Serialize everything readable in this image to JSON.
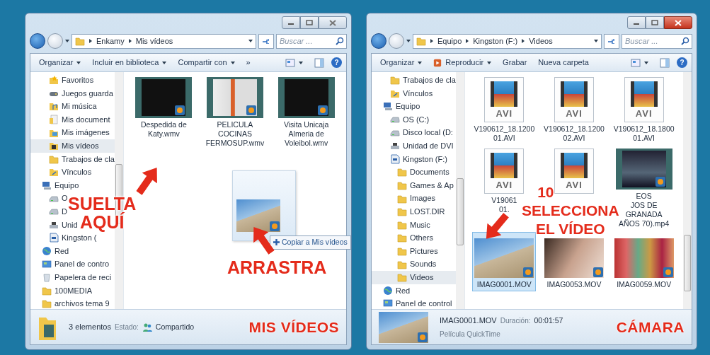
{
  "windows": [
    {
      "active": false,
      "address": [
        "Enkamy",
        "Mis vídeos"
      ],
      "search": {
        "placeholder": "Buscar ..."
      },
      "help": "?",
      "toolbar": [
        {
          "label": "Organizar",
          "dropdown": true
        },
        {
          "label": "Incluir en biblioteca",
          "dropdown": true
        },
        {
          "label": "Compartir con",
          "dropdown": true
        },
        {
          "label": "»",
          "dropdown": false
        }
      ],
      "nav_continued": [
        {
          "label": "Favoritos",
          "kind": "star",
          "selected": false
        },
        {
          "label": "Juegos guarda",
          "kind": "game",
          "selected": false
        },
        {
          "label": "Mi música",
          "kind": "music",
          "selected": false
        },
        {
          "label": "Mis document",
          "kind": "docs",
          "selected": false
        },
        {
          "label": "Mis imágenes",
          "kind": "pics",
          "selected": false
        },
        {
          "label": "Mis vídeos",
          "kind": "vids",
          "selected": true
        },
        {
          "label": "Trabajos de cla",
          "kind": "folder",
          "selected": false
        },
        {
          "label": "Vínculos",
          "kind": "links",
          "selected": false
        }
      ],
      "nav": [
        {
          "label": "Equipo",
          "kind": "computer",
          "selected": false,
          "children": [
            {
              "label": "O",
              "kind": "drive",
              "selected": false
            },
            {
              "label": "D",
              "kind": "drive",
              "selected": false
            },
            {
              "label": "Unid",
              "kind": "dvd",
              "selected": false
            },
            {
              "label": "Kingston (",
              "kind": "sd",
              "selected": false
            }
          ]
        },
        {
          "label": "Red",
          "kind": "network",
          "selected": false
        },
        {
          "label": "Panel de contro",
          "kind": "control",
          "selected": false
        },
        {
          "label": "Papelera de reci",
          "kind": "bin",
          "selected": false
        },
        {
          "label": "100MEDIA",
          "kind": "folder",
          "selected": false
        },
        {
          "label": "archivos tema 9",
          "kind": "folder",
          "selected": false
        }
      ],
      "files": [
        {
          "lines": [
            "Despedida de",
            "Katy.wmv"
          ],
          "kind": "film-dark",
          "selected": false
        },
        {
          "lines": [
            "PELICULA",
            "COCINAS",
            "FERMOSUP.wmv"
          ],
          "kind": "film-logo",
          "selected": false
        },
        {
          "lines": [
            "Visita Unicaja",
            "Almeria de",
            "Voleibol.wmv"
          ],
          "kind": "film-dark",
          "selected": false
        }
      ],
      "drag": {
        "tooltip": "Copiar a Mis vídeos"
      },
      "annotations": [
        {
          "kind": "drop",
          "lines": [
            "SUELTA",
            "AQUÍ"
          ]
        },
        {
          "kind": "drag",
          "lines": [
            "ARRASTRA"
          ]
        }
      ],
      "status": {
        "kind": "folder",
        "title": "3 elementos",
        "pairs": [
          {
            "label": "Estado:",
            "value": "Compartido",
            "kind": "shared"
          }
        ]
      },
      "caption": "MIS VÍDEOS"
    },
    {
      "active": true,
      "address": [
        "Equipo",
        "Kingston (F:)",
        "Videos"
      ],
      "search": {
        "placeholder": "Buscar ..."
      },
      "help": "?",
      "toolbar": [
        {
          "label": "Organizar",
          "dropdown": true
        },
        {
          "label": "Reproducir",
          "dropdown": true,
          "kind": "play"
        },
        {
          "label": "Grabar",
          "dropdown": false
        },
        {
          "label": "Nueva carpeta",
          "dropdown": false
        }
      ],
      "nav_continued": [
        {
          "label": "Trabajos de cla",
          "kind": "folder",
          "selected": false
        },
        {
          "label": "Vínculos",
          "kind": "links",
          "selected": false
        }
      ],
      "nav": [
        {
          "label": "Equipo",
          "kind": "computer",
          "selected": false,
          "children": [
            {
              "label": "OS (C:)",
              "kind": "drive",
              "selected": false
            },
            {
              "label": "Disco local (D:",
              "kind": "drive",
              "selected": false
            },
            {
              "label": "Unidad de DVI",
              "kind": "dvd",
              "selected": false
            },
            {
              "label": "Kingston (F:)",
              "kind": "sd",
              "selected": false,
              "children": [
                {
                  "label": "Documents",
                  "kind": "folder",
                  "selected": false
                },
                {
                  "label": "Games & Ap",
                  "kind": "folder",
                  "selected": false
                },
                {
                  "label": "Images",
                  "kind": "folder",
                  "selected": false
                },
                {
                  "label": "LOST.DIR",
                  "kind": "folder",
                  "selected": false
                },
                {
                  "label": "Music",
                  "kind": "folder",
                  "selected": false
                },
                {
                  "label": "Others",
                  "kind": "folder",
                  "selected": false
                },
                {
                  "label": "Pictures",
                  "kind": "folder",
                  "selected": false
                },
                {
                  "label": "Sounds",
                  "kind": "folder",
                  "selected": false
                },
                {
                  "label": "Videos",
                  "kind": "folder",
                  "selected": true
                }
              ]
            }
          ]
        },
        {
          "label": "Red",
          "kind": "network",
          "selected": false
        },
        {
          "label": "Panel de control",
          "kind": "control",
          "selected": false
        }
      ],
      "files": [
        {
          "lines": [
            "V190612_18.1200",
            "01.AVI"
          ],
          "kind": "avi",
          "icon_text": "AVI",
          "selected": false
        },
        {
          "lines": [
            "V190612_18.1200",
            "02.AVI"
          ],
          "kind": "avi",
          "icon_text": "AVI",
          "selected": false
        },
        {
          "lines": [
            "V190612_18.1800",
            "01.AVI"
          ],
          "kind": "avi",
          "icon_text": "AVI",
          "selected": false
        },
        {
          "lines": [
            "V19061",
            "01."
          ],
          "kind": "avi",
          "icon_text": "AVI",
          "selected": false
        },
        {
          "kind": "avi",
          "icon_text": "AVI",
          "selected": false
        },
        {
          "lines": [
            "EOS",
            "JOS DE",
            "GRANADA",
            "AÑOS 70).mp4"
          ],
          "kind": "film-scene",
          "selected": false
        },
        {
          "lines": [
            "IMAG0001.MOV"
          ],
          "kind": "clip-beach",
          "selected": true
        },
        {
          "lines": [
            "IMAG0053.MOV"
          ],
          "kind": "clip-warm",
          "selected": false
        },
        {
          "lines": [
            "IMAG0059.MOV"
          ],
          "kind": "clip-crowd",
          "selected": false
        }
      ],
      "annotations": [
        {
          "kind": "select",
          "lines": [
            "10",
            "SELECCIONA",
            "EL VÍDEO"
          ]
        }
      ],
      "status": {
        "kind": "file",
        "title": "IMAG0001.MOV",
        "pairs": [
          {
            "label": "Duración:",
            "value": "00:01:57"
          }
        ],
        "subtitle": "Película QuickTime"
      },
      "caption": "CÁMARA"
    }
  ]
}
